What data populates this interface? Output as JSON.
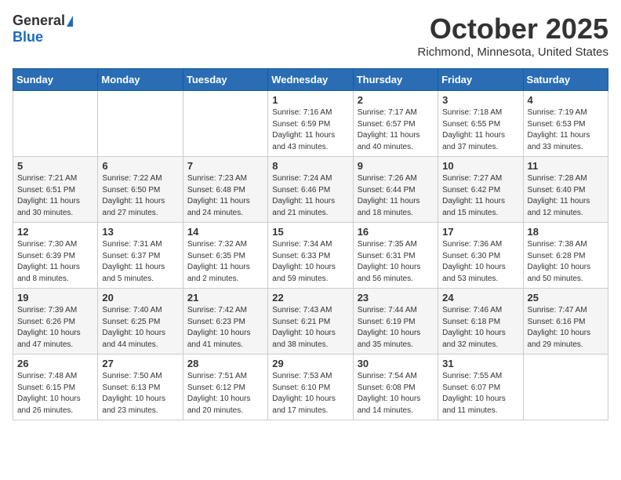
{
  "header": {
    "logo_general": "General",
    "logo_blue": "Blue",
    "month_year": "October 2025",
    "location": "Richmond, Minnesota, United States"
  },
  "days_of_week": [
    "Sunday",
    "Monday",
    "Tuesday",
    "Wednesday",
    "Thursday",
    "Friday",
    "Saturday"
  ],
  "weeks": [
    [
      {
        "day": "",
        "info": ""
      },
      {
        "day": "",
        "info": ""
      },
      {
        "day": "",
        "info": ""
      },
      {
        "day": "1",
        "info": "Sunrise: 7:16 AM\nSunset: 6:59 PM\nDaylight: 11 hours\nand 43 minutes."
      },
      {
        "day": "2",
        "info": "Sunrise: 7:17 AM\nSunset: 6:57 PM\nDaylight: 11 hours\nand 40 minutes."
      },
      {
        "day": "3",
        "info": "Sunrise: 7:18 AM\nSunset: 6:55 PM\nDaylight: 11 hours\nand 37 minutes."
      },
      {
        "day": "4",
        "info": "Sunrise: 7:19 AM\nSunset: 6:53 PM\nDaylight: 11 hours\nand 33 minutes."
      }
    ],
    [
      {
        "day": "5",
        "info": "Sunrise: 7:21 AM\nSunset: 6:51 PM\nDaylight: 11 hours\nand 30 minutes."
      },
      {
        "day": "6",
        "info": "Sunrise: 7:22 AM\nSunset: 6:50 PM\nDaylight: 11 hours\nand 27 minutes."
      },
      {
        "day": "7",
        "info": "Sunrise: 7:23 AM\nSunset: 6:48 PM\nDaylight: 11 hours\nand 24 minutes."
      },
      {
        "day": "8",
        "info": "Sunrise: 7:24 AM\nSunset: 6:46 PM\nDaylight: 11 hours\nand 21 minutes."
      },
      {
        "day": "9",
        "info": "Sunrise: 7:26 AM\nSunset: 6:44 PM\nDaylight: 11 hours\nand 18 minutes."
      },
      {
        "day": "10",
        "info": "Sunrise: 7:27 AM\nSunset: 6:42 PM\nDaylight: 11 hours\nand 15 minutes."
      },
      {
        "day": "11",
        "info": "Sunrise: 7:28 AM\nSunset: 6:40 PM\nDaylight: 11 hours\nand 12 minutes."
      }
    ],
    [
      {
        "day": "12",
        "info": "Sunrise: 7:30 AM\nSunset: 6:39 PM\nDaylight: 11 hours\nand 8 minutes."
      },
      {
        "day": "13",
        "info": "Sunrise: 7:31 AM\nSunset: 6:37 PM\nDaylight: 11 hours\nand 5 minutes."
      },
      {
        "day": "14",
        "info": "Sunrise: 7:32 AM\nSunset: 6:35 PM\nDaylight: 11 hours\nand 2 minutes."
      },
      {
        "day": "15",
        "info": "Sunrise: 7:34 AM\nSunset: 6:33 PM\nDaylight: 10 hours\nand 59 minutes."
      },
      {
        "day": "16",
        "info": "Sunrise: 7:35 AM\nSunset: 6:31 PM\nDaylight: 10 hours\nand 56 minutes."
      },
      {
        "day": "17",
        "info": "Sunrise: 7:36 AM\nSunset: 6:30 PM\nDaylight: 10 hours\nand 53 minutes."
      },
      {
        "day": "18",
        "info": "Sunrise: 7:38 AM\nSunset: 6:28 PM\nDaylight: 10 hours\nand 50 minutes."
      }
    ],
    [
      {
        "day": "19",
        "info": "Sunrise: 7:39 AM\nSunset: 6:26 PM\nDaylight: 10 hours\nand 47 minutes."
      },
      {
        "day": "20",
        "info": "Sunrise: 7:40 AM\nSunset: 6:25 PM\nDaylight: 10 hours\nand 44 minutes."
      },
      {
        "day": "21",
        "info": "Sunrise: 7:42 AM\nSunset: 6:23 PM\nDaylight: 10 hours\nand 41 minutes."
      },
      {
        "day": "22",
        "info": "Sunrise: 7:43 AM\nSunset: 6:21 PM\nDaylight: 10 hours\nand 38 minutes."
      },
      {
        "day": "23",
        "info": "Sunrise: 7:44 AM\nSunset: 6:19 PM\nDaylight: 10 hours\nand 35 minutes."
      },
      {
        "day": "24",
        "info": "Sunrise: 7:46 AM\nSunset: 6:18 PM\nDaylight: 10 hours\nand 32 minutes."
      },
      {
        "day": "25",
        "info": "Sunrise: 7:47 AM\nSunset: 6:16 PM\nDaylight: 10 hours\nand 29 minutes."
      }
    ],
    [
      {
        "day": "26",
        "info": "Sunrise: 7:48 AM\nSunset: 6:15 PM\nDaylight: 10 hours\nand 26 minutes."
      },
      {
        "day": "27",
        "info": "Sunrise: 7:50 AM\nSunset: 6:13 PM\nDaylight: 10 hours\nand 23 minutes."
      },
      {
        "day": "28",
        "info": "Sunrise: 7:51 AM\nSunset: 6:12 PM\nDaylight: 10 hours\nand 20 minutes."
      },
      {
        "day": "29",
        "info": "Sunrise: 7:53 AM\nSunset: 6:10 PM\nDaylight: 10 hours\nand 17 minutes."
      },
      {
        "day": "30",
        "info": "Sunrise: 7:54 AM\nSunset: 6:08 PM\nDaylight: 10 hours\nand 14 minutes."
      },
      {
        "day": "31",
        "info": "Sunrise: 7:55 AM\nSunset: 6:07 PM\nDaylight: 10 hours\nand 11 minutes."
      },
      {
        "day": "",
        "info": ""
      }
    ]
  ]
}
